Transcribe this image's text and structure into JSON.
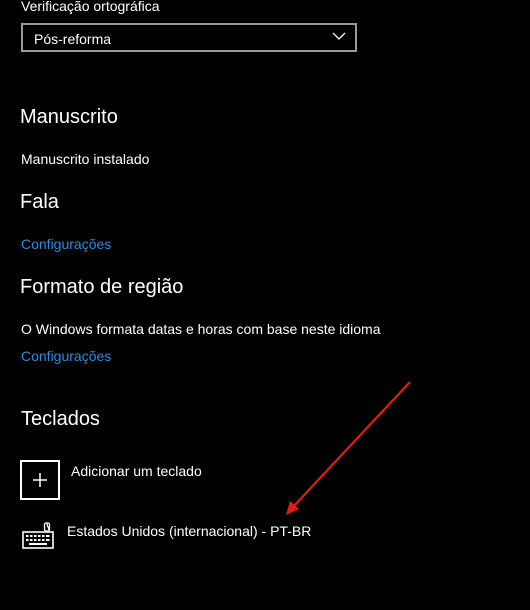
{
  "spellcheck": {
    "label": "Verificação ortográfica",
    "selected": "Pós-reforma"
  },
  "handwriting": {
    "title": "Manuscrito",
    "status": "Manuscrito instalado"
  },
  "speech": {
    "title": "Fala",
    "link": "Configurações"
  },
  "region_format": {
    "title": "Formato de região",
    "description": "O Windows formata datas e horas com base neste idioma",
    "link": "Configurações"
  },
  "keyboards": {
    "title": "Teclados",
    "add_label": "Adicionar um teclado",
    "items": [
      {
        "label": "Estados Unidos (internacional) - PT-BR",
        "icon": "keyboard-icon"
      }
    ]
  },
  "annotation": {
    "arrow_color": "#e31b1b"
  },
  "colors": {
    "background": "#000000",
    "text": "#ffffff",
    "link": "#2b8be0"
  }
}
